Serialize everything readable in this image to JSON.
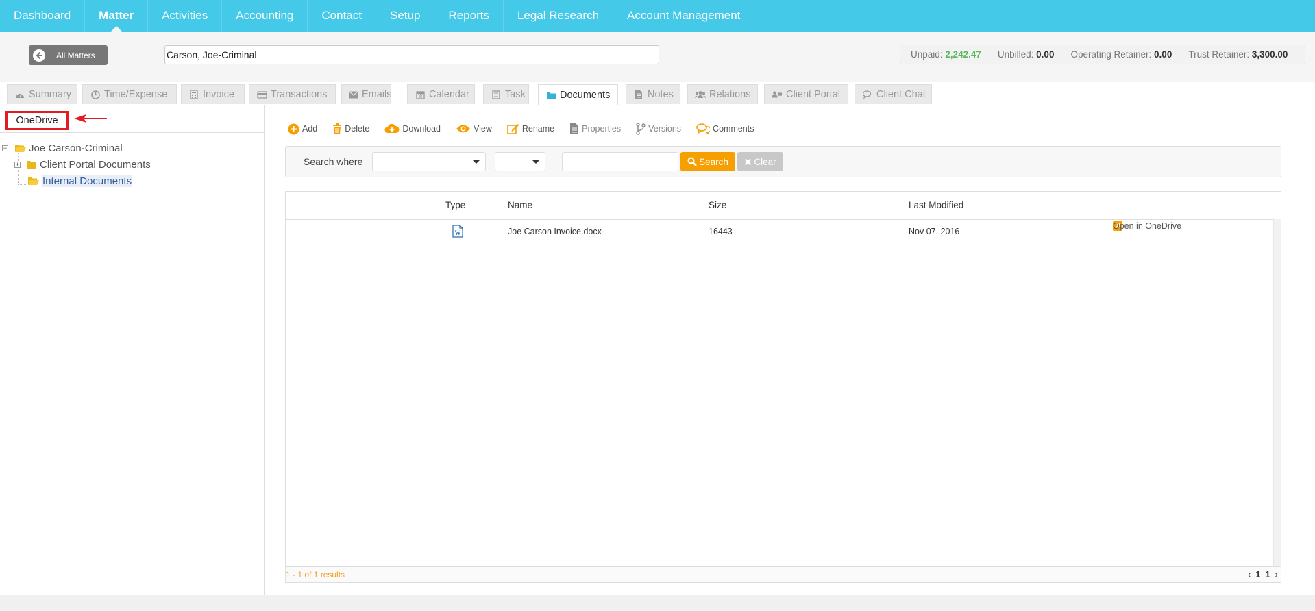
{
  "nav": {
    "items": [
      {
        "label": "Dashboard",
        "active": false
      },
      {
        "label": "Matter",
        "active": true
      },
      {
        "label": "Activities",
        "active": false
      },
      {
        "label": "Accounting",
        "active": false
      },
      {
        "label": "Contact",
        "active": false
      },
      {
        "label": "Setup",
        "active": false
      },
      {
        "label": "Reports",
        "active": false
      },
      {
        "label": "Legal Research",
        "active": false
      },
      {
        "label": "Account Management",
        "active": false
      }
    ]
  },
  "header": {
    "all_matters_label": "All Matters",
    "matter_value": "Carson, Joe-Criminal",
    "balances": {
      "unpaid_label": "Unpaid:",
      "unpaid_value": "2,242.47",
      "unbilled_label": "Unbilled:",
      "unbilled_value": "0.00",
      "operating_label": "Operating Retainer:",
      "operating_value": "0.00",
      "trust_label": "Trust Retainer:",
      "trust_value": "3,300.00"
    }
  },
  "tabs": [
    {
      "label": "Summary",
      "icon": "dashboard-icon"
    },
    {
      "label": "Time/Expense",
      "icon": "clock-icon"
    },
    {
      "label": "Invoice",
      "icon": "calculator-icon"
    },
    {
      "label": "Transactions",
      "icon": "credit-card-icon"
    },
    {
      "label": "Emails",
      "icon": "envelope-icon"
    },
    {
      "label": "Calendar",
      "icon": "calendar-icon"
    },
    {
      "label": "Task",
      "icon": "task-icon"
    },
    {
      "label": "Documents",
      "icon": "folder-icon",
      "active": true
    },
    {
      "label": "Notes",
      "icon": "notes-icon"
    },
    {
      "label": "Relations",
      "icon": "users-icon"
    },
    {
      "label": "Client Portal",
      "icon": "portal-icon"
    },
    {
      "label": "Client Chat",
      "icon": "chat-icon"
    }
  ],
  "left_panel": {
    "source_label": "OneDrive",
    "tree": {
      "root": "Joe Carson-Criminal",
      "children": [
        "Client Portal Documents",
        "Internal Documents"
      ]
    }
  },
  "toolbar": {
    "add": "Add",
    "delete": "Delete",
    "download": "Download",
    "view": "View",
    "rename": "Rename",
    "properties": "Properties",
    "versions": "Versions",
    "comments": "Comments"
  },
  "search": {
    "label": "Search where",
    "button_search": "Search",
    "button_clear": "Clear"
  },
  "grid": {
    "columns": [
      "Type",
      "Name",
      "Size",
      "Last Modified"
    ],
    "rows": [
      {
        "type_icon": "word-doc-icon",
        "name": "Joe Carson Invoice.docx",
        "size": "16443",
        "modified": "Nov 07, 2016",
        "action": "Open in OneDrive"
      }
    ],
    "results_text": "1 - 1 of 1 results",
    "pager": {
      "prev": "‹",
      "page": "1",
      "total": "1",
      "next": "›"
    }
  },
  "colors": {
    "nav_bg": "#44c9e8",
    "accent_orange": "#f5a000",
    "unpaid_green": "#5cb85c",
    "annotation_red": "#e31b23"
  }
}
